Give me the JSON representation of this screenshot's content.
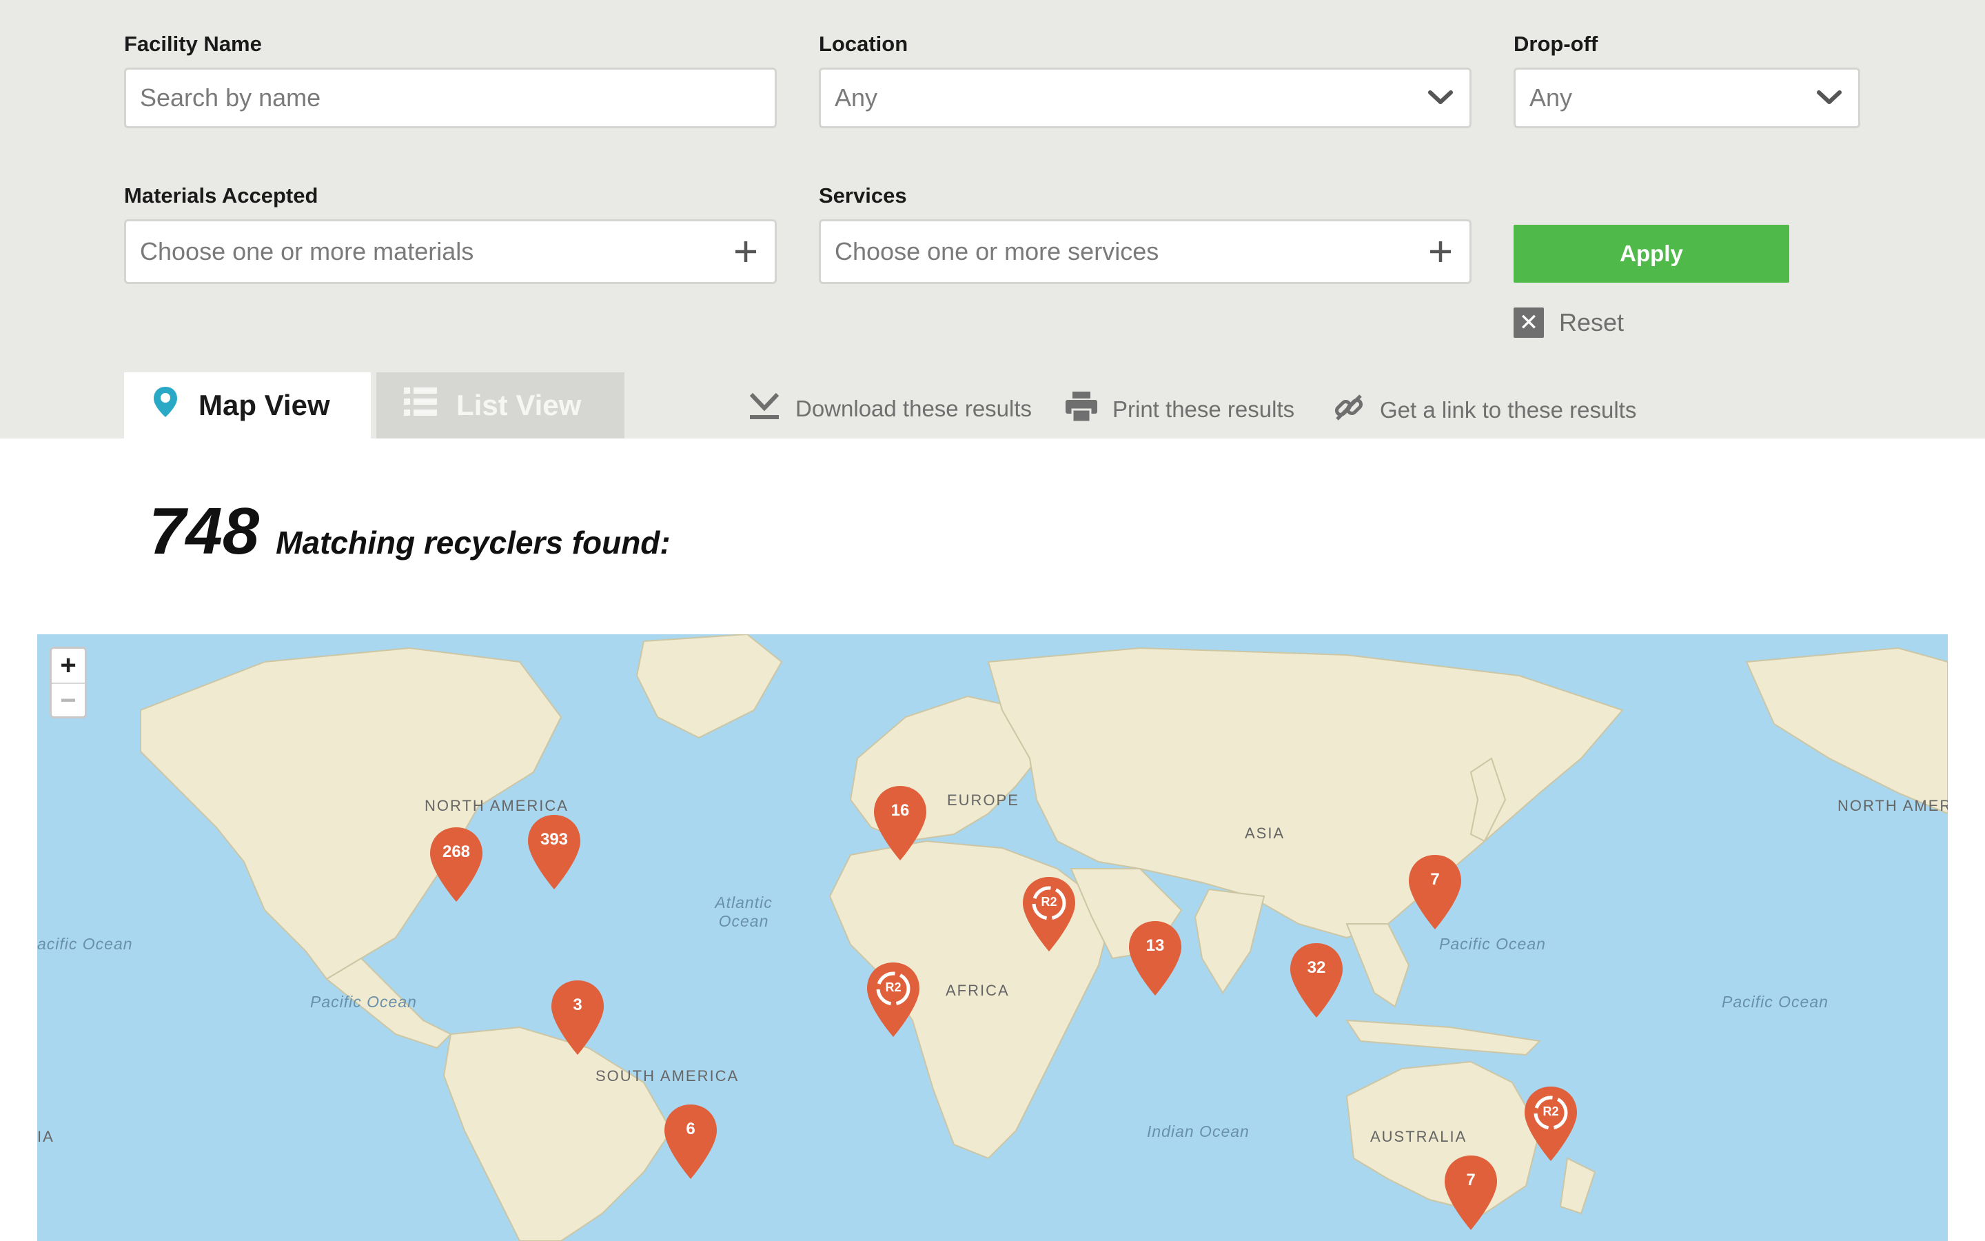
{
  "filters": {
    "facility_name": {
      "label": "Facility Name",
      "placeholder": "Search by name"
    },
    "location": {
      "label": "Location",
      "value": "Any"
    },
    "dropoff": {
      "label": "Drop-off",
      "value": "Any"
    },
    "materials": {
      "label": "Materials Accepted",
      "placeholder": "Choose one or more materials"
    },
    "services": {
      "label": "Services",
      "placeholder": "Choose one or more services"
    },
    "apply_label": "Apply",
    "reset_label": "Reset"
  },
  "tabs": {
    "map_view": "Map View",
    "list_view": "List View"
  },
  "actions": {
    "download": "Download these results",
    "print": "Print these results",
    "link": "Get a link to these results"
  },
  "results": {
    "count": "748",
    "label": "Matching recyclers found:"
  },
  "map": {
    "zoom_in": "+",
    "zoom_out": "−",
    "regions": {
      "north_america": "NORTH AMERICA",
      "europe": "EUROPE",
      "asia": "ASIA",
      "africa": "AFRICA",
      "south_america": "SOUTH AMERICA",
      "australia": "AUSTRALIA",
      "north_america_right": "NORTH AMER",
      "asia_left": "IA"
    },
    "oceans": {
      "atlantic": "Atlantic Ocean",
      "pacific_left": "acific Ocean",
      "pacific_1": "Pacific Ocean",
      "pacific_2": "Pacific Ocean",
      "pacific_3": "Pacific Ocean",
      "indian": "Indian Ocean"
    },
    "markers": {
      "m268": "268",
      "m393": "393",
      "m16": "16",
      "m7a": "7",
      "m13": "13",
      "m32": "32",
      "m3": "3",
      "m6": "6",
      "m7b": "7",
      "r2": "R2"
    },
    "colors": {
      "marker": "#e0603c",
      "land": "#efead0",
      "water": "#a8d7ef"
    }
  }
}
